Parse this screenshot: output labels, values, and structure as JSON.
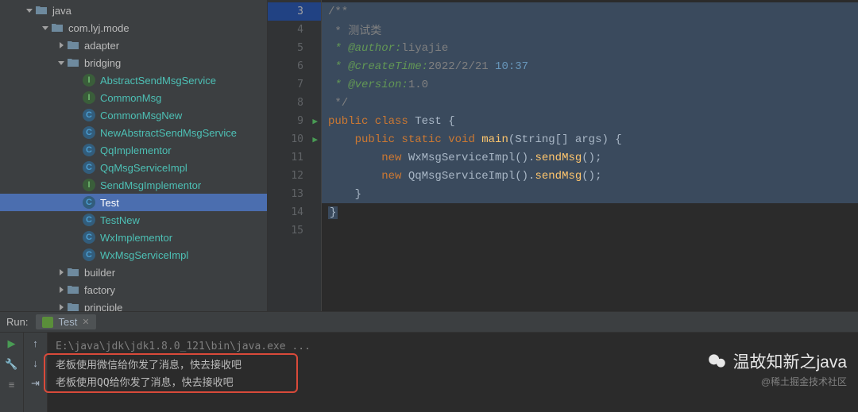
{
  "tree": {
    "java": "java",
    "package": "com.lyj.mode",
    "adapter": "adapter",
    "bridging": "bridging",
    "files": [
      "AbstractSendMsgService",
      "CommonMsg",
      "CommonMsgNew",
      "NewAbstractSendMsgService",
      "QqImplementor",
      "QqMsgServiceImpl",
      "SendMsgImplementor",
      "Test",
      "TestNew",
      "WxImplementor",
      "WxMsgServiceImpl"
    ],
    "builder": "builder",
    "factory": "factory",
    "principle": "principle"
  },
  "code": {
    "lines": [
      "3",
      "4",
      "5",
      "6",
      "7",
      "8",
      "9",
      "10",
      "11",
      "12",
      "13",
      "14",
      "15"
    ],
    "l3": "/**",
    "l4": " * 测试类",
    "l5a": " * @author:",
    "l5b": "liyajie",
    "l6a": " * @createTime:",
    "l6b": "2022/2/21 ",
    "l6c": "10:37",
    "l7a": " * @version:",
    "l7b": "1.0",
    "l8": " */",
    "l9a": "public class ",
    "l9b": "Test ",
    "l9c": "{",
    "l10a": "    public static ",
    "l10b": "void ",
    "l10c": "main",
    "l10d": "(String[] args) {",
    "l11a": "        new ",
    "l11b": "WxMsgServiceImpl().",
    "l11c": "sendMsg",
    "l11d": "();",
    "l12a": "        new ",
    "l12b": "QqMsgServiceImpl().",
    "l12c": "sendMsg",
    "l12d": "();",
    "l13": "    }",
    "l14": "}",
    "l15": ""
  },
  "run": {
    "label": "Run:",
    "tab": "Test",
    "exe": "E:\\java\\jdk\\jdk1.8.0_121\\bin\\java.exe ...",
    "out1": "老板使用微信给你发了消息，快去接收吧",
    "out2": "老板使用QQ给你发了消息，快去接收吧"
  },
  "watermark": {
    "line1": "温故知新之java",
    "line2": "@稀土掘金技术社区"
  }
}
